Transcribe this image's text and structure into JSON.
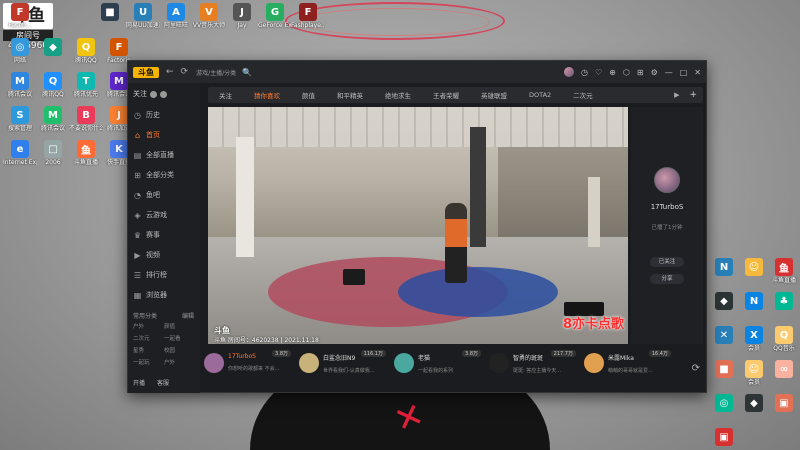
{
  "room": {
    "logo": "斗鱼",
    "label": "房间号",
    "number": "4806960"
  },
  "desktop_icons_left": [
    {
      "label": "Faceh...",
      "color": "#c0392b",
      "glyph": "F"
    },
    {
      "label": "",
      "color": "#2c3e50",
      "glyph": "■"
    },
    {
      "label": "网易UU加速器",
      "color": "#2980b9",
      "glyph": "U"
    },
    {
      "label": "阿里旺旺",
      "color": "#1e88e5",
      "glyph": "A"
    },
    {
      "label": "VV音乐大师",
      "color": "#e67e22",
      "glyph": "V"
    },
    {
      "label": "Jay",
      "color": "#555555",
      "glyph": "J"
    },
    {
      "label": "GeForce Experience",
      "color": "#27ae60",
      "glyph": "G"
    },
    {
      "label": "Fashplaye...",
      "color": "#8e2020",
      "glyph": "F"
    },
    {
      "label": "网络",
      "color": "#3498db",
      "glyph": "◎"
    },
    {
      "label": "",
      "color": "#16a085",
      "glyph": "◆"
    },
    {
      "label": "腾讯QQ",
      "color": "#f1c40f",
      "glyph": "Q"
    },
    {
      "label": "Factorio",
      "color": "#d35400",
      "glyph": "F"
    },
    {
      "label": "腾讯会议",
      "color": "#2e86de",
      "glyph": "M"
    },
    {
      "label": "腾讯QQ",
      "color": "#1e90ff",
      "glyph": "Q"
    },
    {
      "label": "腾讯优先",
      "color": "#0fb9b1",
      "glyph": "T"
    },
    {
      "label": "腾讯会议",
      "color": "#5f27cd",
      "glyph": "M"
    },
    {
      "label": "搜索管理",
      "color": "#2d98da",
      "glyph": "S"
    },
    {
      "label": "腾讯会议",
      "color": "#20bf6b",
      "glyph": "M"
    },
    {
      "label": "不要说你什么都在做",
      "color": "#eb3b5a",
      "glyph": "B"
    },
    {
      "label": "腾讯加速",
      "color": "#fa8231",
      "glyph": "J"
    },
    {
      "label": "Internet Explorer",
      "color": "#2f80ed",
      "glyph": "e"
    },
    {
      "label": "2006",
      "color": "#95a5a6",
      "glyph": "□"
    },
    {
      "label": "斗鱼直播",
      "color": "#ff6b35",
      "glyph": "鱼"
    },
    {
      "label": "快手直播",
      "color": "#4b7bec",
      "glyph": "K"
    }
  ],
  "desktop_icons_right": [
    {
      "label": "",
      "color": "#2980b9",
      "glyph": "N"
    },
    {
      "label": "",
      "color": "#f6b93b",
      "glyph": "☺"
    },
    {
      "label": "斗鱼直播",
      "color": "#d63031",
      "glyph": "鱼"
    },
    {
      "label": "",
      "color": "#2d3436",
      "glyph": "◆"
    },
    {
      "label": "",
      "color": "#0984e3",
      "glyph": "N"
    },
    {
      "label": "",
      "color": "#00b894",
      "glyph": "♣"
    },
    {
      "label": "",
      "color": "#2980b9",
      "glyph": "✕"
    },
    {
      "label": "会员",
      "color": "#0984e3",
      "glyph": "X"
    },
    {
      "label": "QQ音乐",
      "color": "#fdcb6e",
      "glyph": "Q"
    },
    {
      "label": "",
      "color": "#e17055",
      "glyph": "■"
    },
    {
      "label": "会员",
      "color": "#fdcb6e",
      "glyph": "☺"
    },
    {
      "label": "",
      "color": "#fab1a0",
      "glyph": "∞"
    },
    {
      "label": "",
      "color": "#00b894",
      "glyph": "◎"
    },
    {
      "label": "",
      "color": "#2d3436",
      "glyph": "◆"
    },
    {
      "label": "",
      "color": "#e17055",
      "glyph": "▣"
    },
    {
      "label": "",
      "color": "#d63031",
      "glyph": "▣"
    }
  ],
  "app": {
    "logo": "斗鱼",
    "address": "游戏/主播/分类",
    "search_icon": "🔍",
    "toolbar_icons": [
      "◷",
      "♡",
      "⊕",
      "⬡",
      "⊞",
      "⚙",
      "—",
      "□",
      "✕"
    ]
  },
  "sidebar": {
    "follow": "关注",
    "history": "历史",
    "items": [
      {
        "icon": "⌂",
        "label": "首页",
        "active": true
      },
      {
        "icon": "▤",
        "label": "全部直播",
        "active": false
      },
      {
        "icon": "⊞",
        "label": "全部分类",
        "active": false
      },
      {
        "icon": "◔",
        "label": "鱼吧",
        "active": false
      },
      {
        "icon": "◈",
        "label": "云游戏",
        "active": false
      },
      {
        "icon": "♛",
        "label": "赛事",
        "active": false
      },
      {
        "icon": "▶",
        "label": "视频",
        "active": false
      },
      {
        "icon": "☰",
        "label": "排行榜",
        "active": false
      },
      {
        "icon": "▦",
        "label": "浏览器",
        "active": false
      }
    ],
    "section_title": "常用分类",
    "section_action": "编辑",
    "grid": [
      "户外",
      "颜值",
      "二次元",
      "一起看",
      "星秀",
      "校园",
      "一起玩",
      "户外"
    ],
    "footer": [
      "开播",
      "客服"
    ]
  },
  "categories": {
    "tabs": [
      "关注",
      "猜你喜欢",
      "颜值",
      "和平精英",
      "绝地求生",
      "王者荣耀",
      "英雄联盟",
      "DOTA2",
      "二次元"
    ],
    "active_index": 1,
    "more": "▶",
    "add": "+"
  },
  "video": {
    "watermark": "斗鱼",
    "room_info": "斗鱼 房间号：4620238 | 2021.11.18",
    "overlay_text": "8亦卡点歌"
  },
  "streamer": {
    "name": "17TurboS",
    "status": "已播了1分钟",
    "btn_follow": "已关注",
    "btn_share": "分享"
  },
  "recommendations": [
    {
      "name": "17TurboS",
      "desc": "你想听的歌都来 不会...",
      "viewers": "3.8万",
      "avatar": "#9b6b9b",
      "hot": true
    },
    {
      "name": "白鲨念旧N9",
      "desc": "世界看我们-认真做我...",
      "viewers": "116.1万",
      "avatar": "#c9b27a",
      "hot": false
    },
    {
      "name": "老猫",
      "desc": "一起看我的系列",
      "viewers": "3.8万",
      "avatar": "#4aa8a0",
      "hot": false
    },
    {
      "name": "智勇的斑斑",
      "desc": "斑斑: 答应主播今天...",
      "viewers": "217.7万",
      "avatar": "#222222",
      "hot": false
    },
    {
      "name": "米露Mika",
      "desc": "萌萌的哥哥就是爱...",
      "viewers": "16.4万",
      "avatar": "#e0a050",
      "hot": false
    }
  ],
  "refresh_icon": "⟳"
}
